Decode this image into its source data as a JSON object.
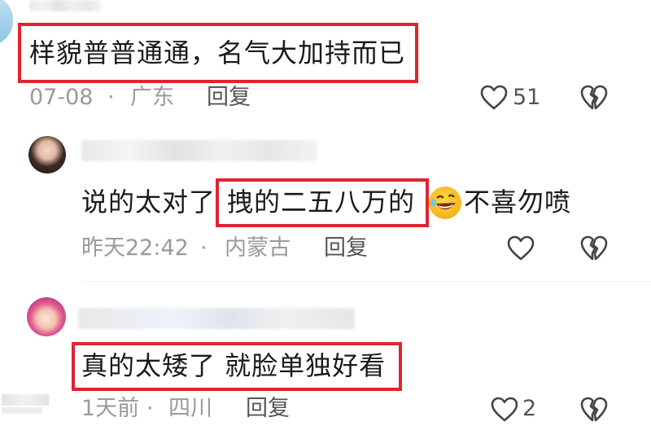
{
  "colors": {
    "highlight": "#e0242e",
    "meta_text": "#9a9a9a",
    "icon": "#444444"
  },
  "comments": [
    {
      "text": "样貌普普通通，名气大加持而已",
      "date": "07-08",
      "separator": "·",
      "location": "广东",
      "reply_label": "回复",
      "like_icon": "heart-outline-icon",
      "like_count": "51",
      "dislike_icon": "broken-heart-icon"
    },
    {
      "text_before": "说的太对了",
      "text_highlight": "拽的二五八万的",
      "emoji_icon": "rolling-laughing-emoji-icon",
      "text_after": "不喜勿喷",
      "date": "昨天22:42",
      "separator": "·",
      "location": "内蒙古",
      "reply_label": "回复",
      "like_icon": "heart-outline-icon",
      "dislike_icon": "broken-heart-icon"
    },
    {
      "text_highlight": "真的太矮了 就脸单独好看",
      "date": "1天前",
      "separator": "·",
      "location": "四川",
      "reply_label": "回复",
      "like_icon": "heart-outline-icon",
      "like_count": "2",
      "dislike_icon": "broken-heart-icon"
    }
  ]
}
